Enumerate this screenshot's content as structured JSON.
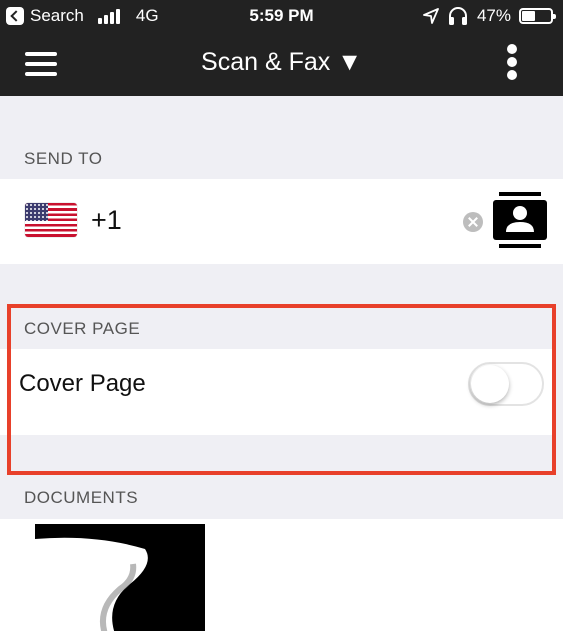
{
  "status_bar": {
    "back_app": "Search",
    "network": "4G",
    "time": "5:59 PM",
    "battery": "47%",
    "battery_fraction": 0.47
  },
  "nav": {
    "title": "Scan & Fax ▼",
    "menu_icon": "hamburger-menu-icon",
    "more_icon": "more-vertical-icon"
  },
  "send_to": {
    "header": "SEND TO",
    "country_flag": "us-flag-icon",
    "country_code": "+1",
    "clear_icon": "clear-icon",
    "contacts_icon": "contacts-icon"
  },
  "cover_page": {
    "header": "COVER PAGE",
    "label": "Cover Page",
    "toggle_on": false
  },
  "documents": {
    "header": "DOCUMENTS"
  },
  "colors": {
    "top_bar": "#222222",
    "background": "#efeff4",
    "highlight": "#e8402a"
  }
}
